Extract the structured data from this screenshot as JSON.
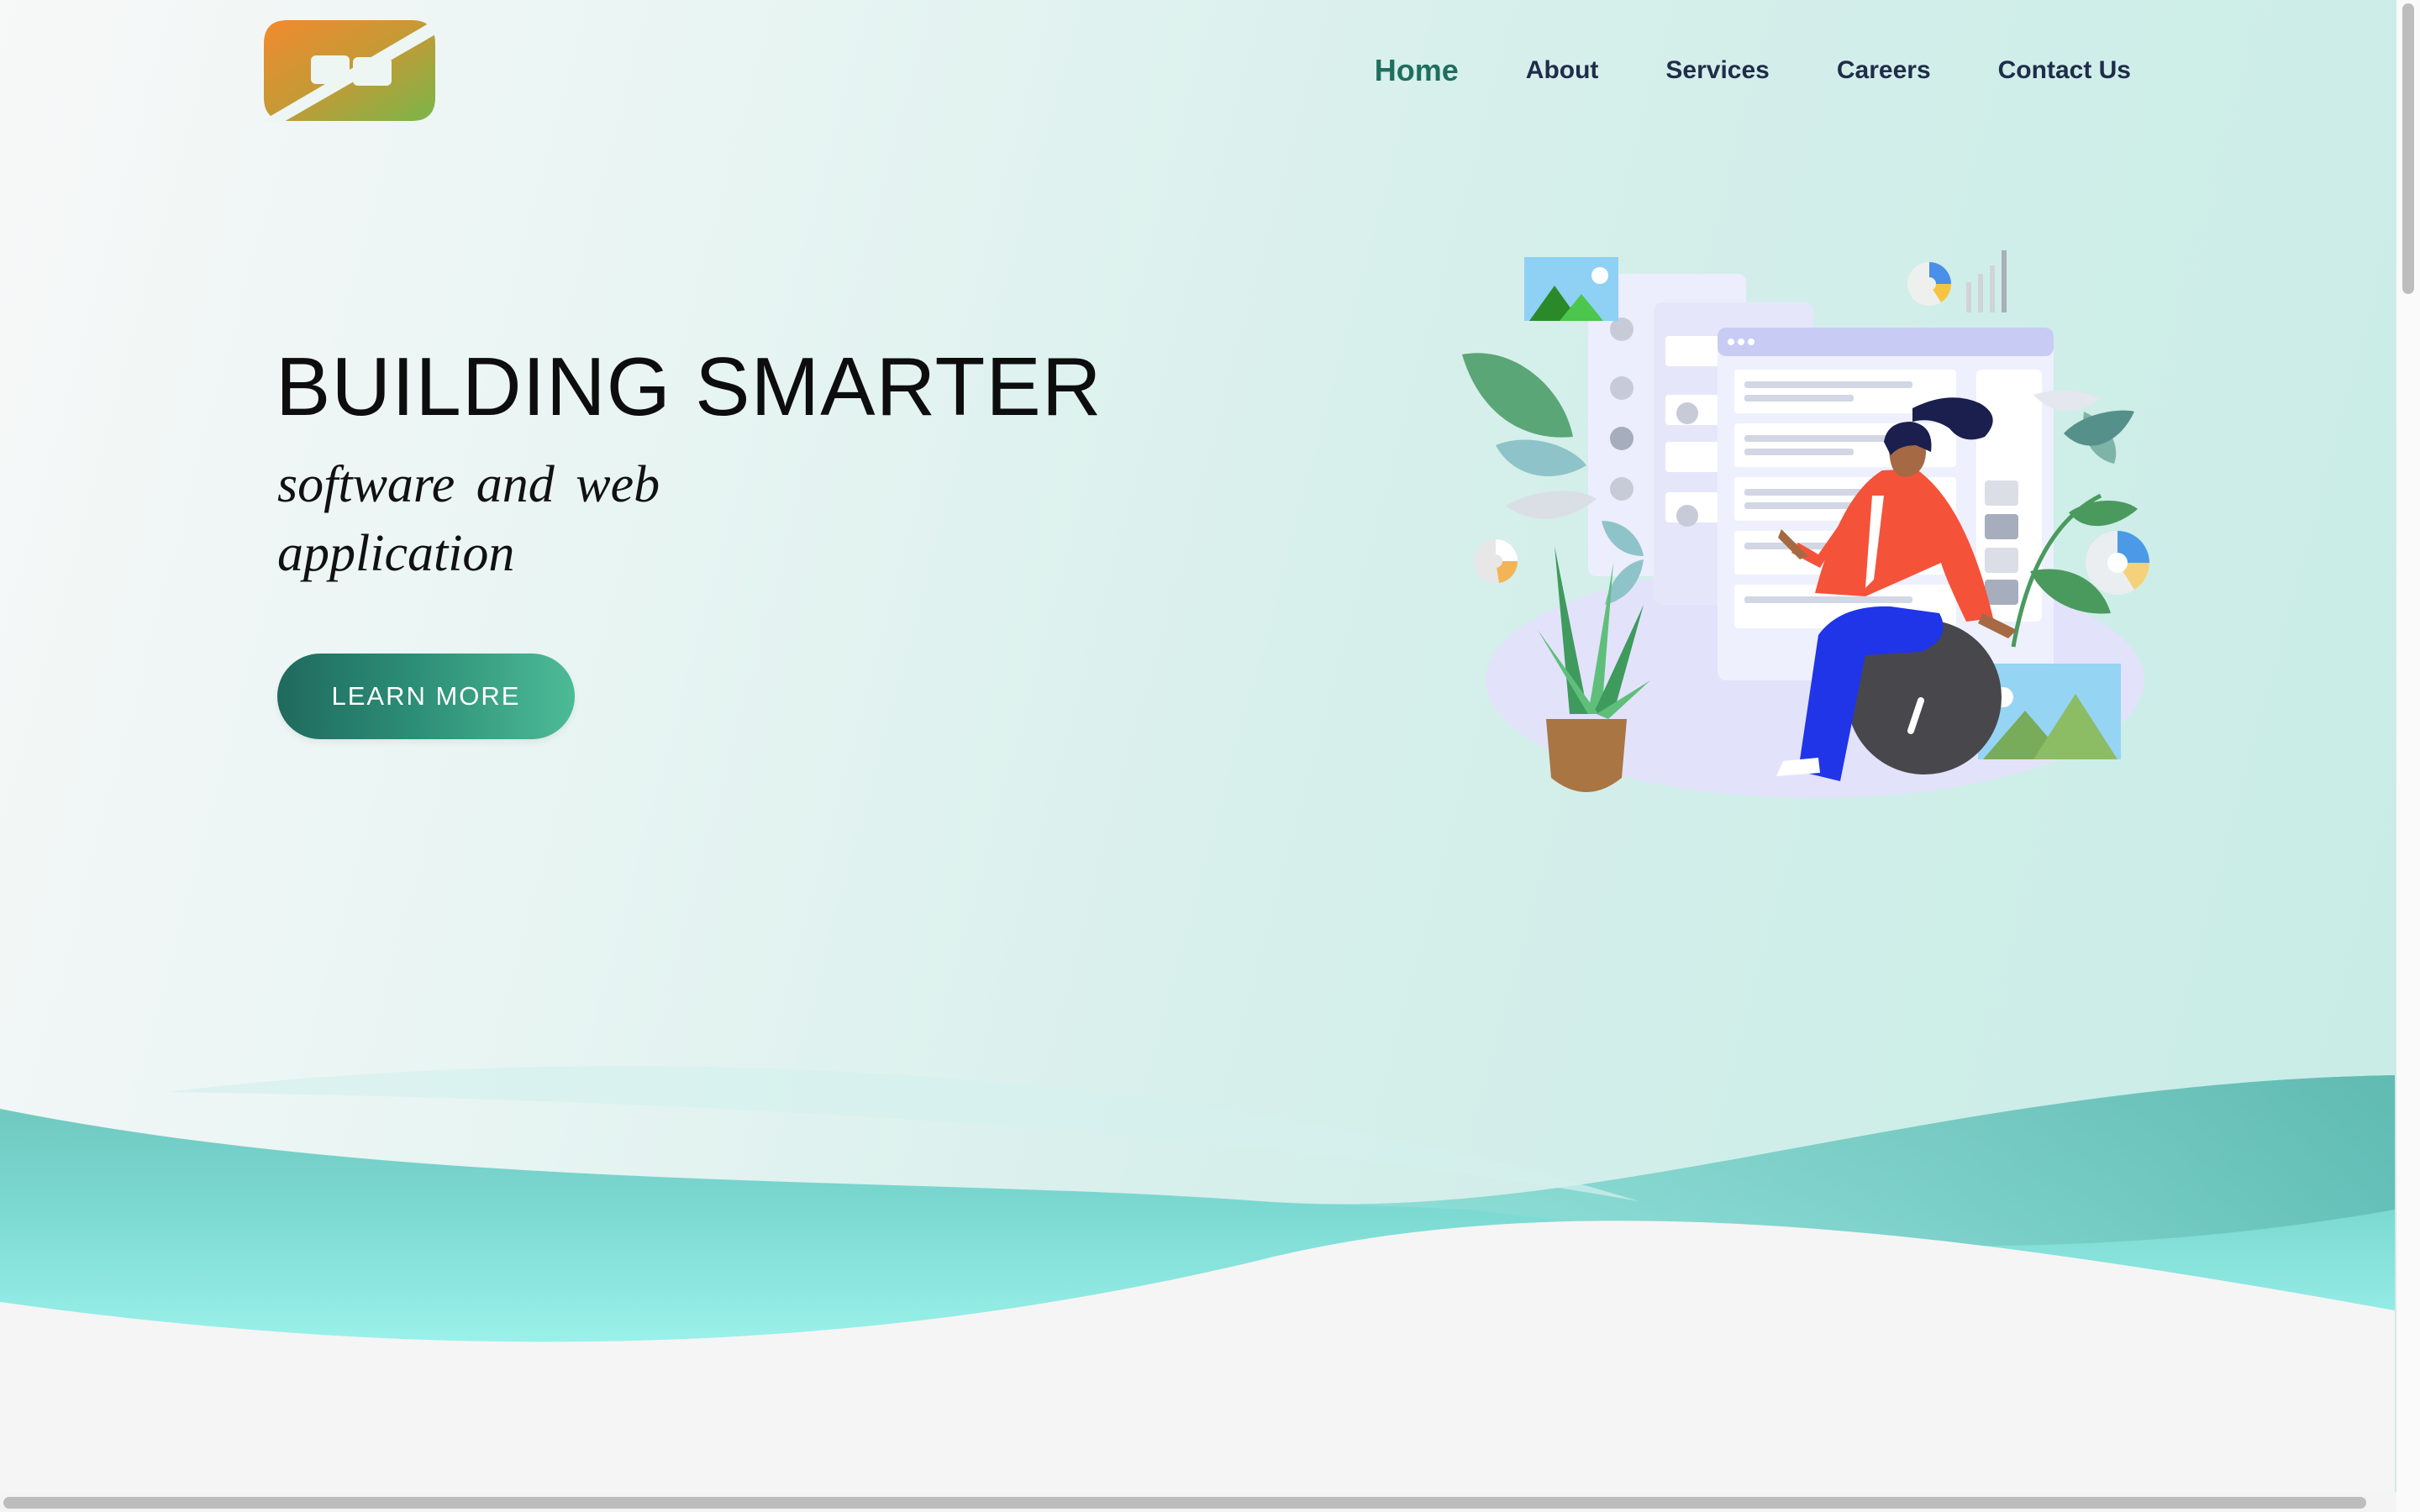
{
  "nav": {
    "items": [
      {
        "label": "Home",
        "active": true
      },
      {
        "label": "About"
      },
      {
        "label": "Services"
      },
      {
        "label": "Careers"
      },
      {
        "label": "Contact Us"
      }
    ]
  },
  "hero": {
    "title": "BUILDING SMARTER",
    "subtitle": "software and web application",
    "cta_label": "LEARN MORE"
  },
  "colors": {
    "brand_orange": "#ef8a2f",
    "brand_green": "#7fb64a",
    "active_nav": "#1f6f5e",
    "nav_text": "#1f2c4a",
    "button_start": "#1f6a5e",
    "button_end": "#4dbb96",
    "wave_teal": "#5fcfcc"
  },
  "icons": [
    "logo-mark",
    "landscape-image-icon",
    "pie-chart-icon",
    "bar-chart-icon",
    "donut-chart-icon"
  ]
}
